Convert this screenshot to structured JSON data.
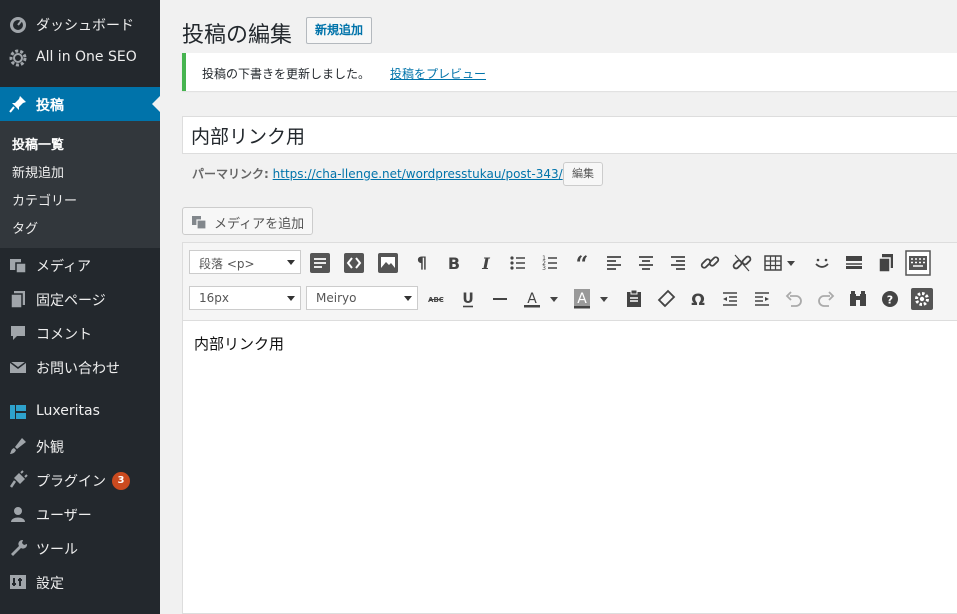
{
  "sidebar": {
    "items": [
      {
        "label": "ダッシュボード",
        "icon": "dashboard-icon"
      },
      {
        "label": "All in One SEO",
        "icon": "gear-icon"
      },
      {
        "label": "投稿",
        "icon": "pin-icon"
      },
      {
        "label": "メディア",
        "icon": "media-icon"
      },
      {
        "label": "固定ページ",
        "icon": "pages-icon"
      },
      {
        "label": "コメント",
        "icon": "comment-icon"
      },
      {
        "label": "お問い合わせ",
        "icon": "mail-icon"
      },
      {
        "label": "Luxeritas",
        "icon": "grid-icon"
      },
      {
        "label": "外観",
        "icon": "brush-icon"
      },
      {
        "label": "プラグイン",
        "icon": "plugin-icon",
        "badge": "3"
      },
      {
        "label": "ユーザー",
        "icon": "user-icon"
      },
      {
        "label": "ツール",
        "icon": "wrench-icon"
      },
      {
        "label": "設定",
        "icon": "settings-icon"
      }
    ],
    "submenu": [
      "投稿一覧",
      "新規追加",
      "カテゴリー",
      "タグ"
    ]
  },
  "header": {
    "title": "投稿の編集",
    "add_new": "新規追加"
  },
  "notice": {
    "text": "投稿の下書きを更新しました。",
    "link": "投稿をプレビュー"
  },
  "post": {
    "title": "内部リンク用",
    "permalink_label": "パーマリンク:",
    "permalink_base": "https://cha-llenge.net/wordpresstukau/",
    "permalink_slug": "post-343",
    "permalink_tail": "/",
    "permalink_edit": "編集",
    "body": "内部リンク用"
  },
  "media_button": "メディアを追加",
  "toolbar": {
    "format_select": "段落 <p>",
    "size_select": "16px",
    "font_select": "Meiryo"
  },
  "colors": {
    "sidebar_bg": "#23282d",
    "submenu_bg": "#32373c",
    "accent": "#0073aa",
    "notice_border": "#46b450",
    "badge": "#ca4a1f"
  }
}
